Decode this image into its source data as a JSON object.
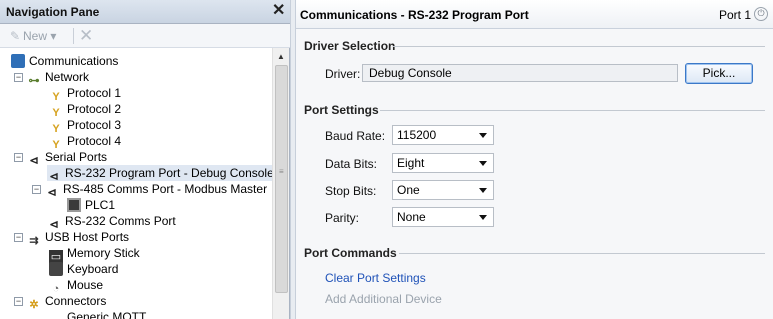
{
  "nav": {
    "title": "Navigation Pane",
    "close_icon": "close-icon",
    "toolbar": {
      "new_label": "New",
      "new_dropdown": "▾"
    },
    "tree": [
      {
        "label": "Communications",
        "icon": "computer-icon",
        "toggle": ""
      },
      {
        "label": "Network",
        "icon": "network-icon",
        "toggle": "−"
      },
      {
        "label": "Protocol 1",
        "icon": "protocol-icon",
        "toggle": ""
      },
      {
        "label": "Protocol 2",
        "icon": "protocol-icon",
        "toggle": ""
      },
      {
        "label": "Protocol 3",
        "icon": "protocol-icon",
        "toggle": ""
      },
      {
        "label": "Protocol 4",
        "icon": "protocol-icon",
        "toggle": ""
      },
      {
        "label": "Serial Ports",
        "icon": "serial-port-icon",
        "toggle": "−"
      },
      {
        "label": "RS-232 Program Port - Debug Console",
        "icon": "serial-port-icon",
        "toggle": "",
        "selected": true
      },
      {
        "label": "RS-485 Comms Port - Modbus Master",
        "icon": "serial-port-icon",
        "toggle": "−"
      },
      {
        "label": "PLC1",
        "icon": "plc-icon",
        "toggle": ""
      },
      {
        "label": "RS-232 Comms Port",
        "icon": "serial-port-icon",
        "toggle": ""
      },
      {
        "label": "USB Host Ports",
        "icon": "usb-icon",
        "toggle": "−"
      },
      {
        "label": "Memory Stick",
        "icon": "memory-stick-icon",
        "toggle": ""
      },
      {
        "label": "Keyboard",
        "icon": "keyboard-icon",
        "toggle": ""
      },
      {
        "label": "Mouse",
        "icon": "mouse-icon",
        "toggle": ""
      },
      {
        "label": "Connectors",
        "icon": "connectors-icon",
        "toggle": "−"
      },
      {
        "label": "Generic MQTT",
        "icon": "cloud-icon",
        "toggle": ""
      }
    ]
  },
  "main": {
    "title": "Communications - RS-232 Program Port",
    "port_label": "Port 1",
    "driver_section": {
      "title": "Driver Selection",
      "driver_label": "Driver:",
      "driver_value": "Debug Console",
      "pick_label": "Pick..."
    },
    "port_settings": {
      "title": "Port Settings",
      "fields": [
        {
          "label": "Baud Rate:",
          "value": "115200"
        },
        {
          "label": "Data Bits:",
          "value": "Eight"
        },
        {
          "label": "Stop Bits:",
          "value": "One"
        },
        {
          "label": "Parity:",
          "value": "None"
        }
      ]
    },
    "port_commands": {
      "title": "Port Commands",
      "clear_label": "Clear Port Settings",
      "add_label": "Add Additional Device"
    }
  },
  "colors": {
    "link": "#1f52b8",
    "disabled": "#9aa3ad",
    "selection": "#dfe7f2",
    "pick_border": "#3b78c8"
  }
}
